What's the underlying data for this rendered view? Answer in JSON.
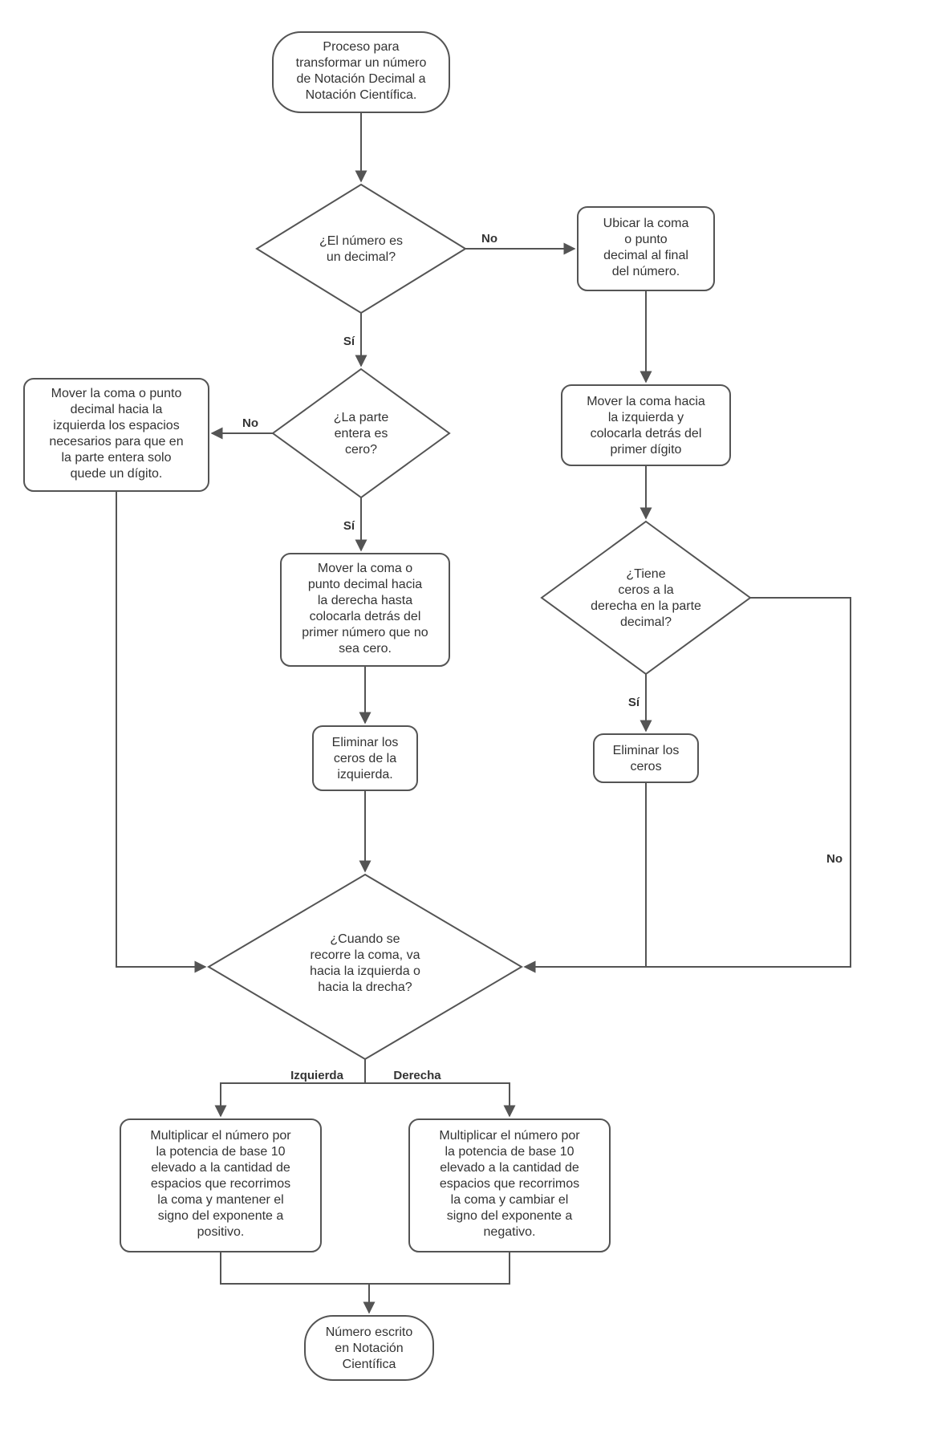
{
  "nodes": {
    "start": {
      "lines": [
        "Proceso para",
        "transformar un número",
        "de Notación Decimal a",
        "Notación Científica."
      ]
    },
    "d_decimal": {
      "lines": [
        "¿El número es",
        "un decimal?"
      ]
    },
    "p_ubicar": {
      "lines": [
        "Ubicar la coma",
        "o punto",
        "decimal al final",
        "del número."
      ]
    },
    "p_mover_izq_no": {
      "lines": [
        "Mover la coma o punto",
        "decimal hacia la",
        "izquierda los espacios",
        "necesarios para que en",
        "la parte entera solo",
        "quede un dígito."
      ]
    },
    "d_entera": {
      "lines": [
        "¿La parte",
        "entera es",
        "cero?"
      ]
    },
    "p_mover_izq_primer": {
      "lines": [
        "Mover la coma hacia",
        "la izquierda y",
        "colocarla detrás del",
        "primer dígito"
      ]
    },
    "p_mover_der": {
      "lines": [
        "Mover la coma o",
        "punto decimal hacia",
        "la derecha hasta",
        "colocarla detrás del",
        "primer número que no",
        "sea cero."
      ]
    },
    "d_ceros": {
      "lines": [
        "¿Tiene",
        "ceros a la",
        "derecha en la parte",
        "decimal?"
      ]
    },
    "p_elim_izq": {
      "lines": [
        "Eliminar los",
        "ceros de la",
        "izquierda."
      ]
    },
    "p_elim_ceros": {
      "lines": [
        "Eliminar los",
        "ceros"
      ]
    },
    "d_direccion": {
      "lines": [
        "¿Cuando se",
        "recorre la coma, va",
        "hacia la izquierda o",
        "hacia la drecha?"
      ]
    },
    "p_mult_pos": {
      "lines": [
        "Multiplicar el número por",
        "la potencia de base 10",
        "elevado a la cantidad de",
        "espacios que recorrimos",
        "la coma y mantener el",
        "signo del exponente a",
        "positivo."
      ]
    },
    "p_mult_neg": {
      "lines": [
        "Multiplicar el número por",
        "la potencia de base 10",
        "elevado a la cantidad de",
        "espacios que recorrimos",
        "la coma y cambiar el",
        "signo del exponente a",
        "negativo."
      ]
    },
    "end": {
      "lines": [
        "Número escrito",
        "en Notación",
        "Científica"
      ]
    }
  },
  "labels": {
    "si": "Sí",
    "no": "No",
    "izq": "Izquierda",
    "der": "Derecha"
  }
}
